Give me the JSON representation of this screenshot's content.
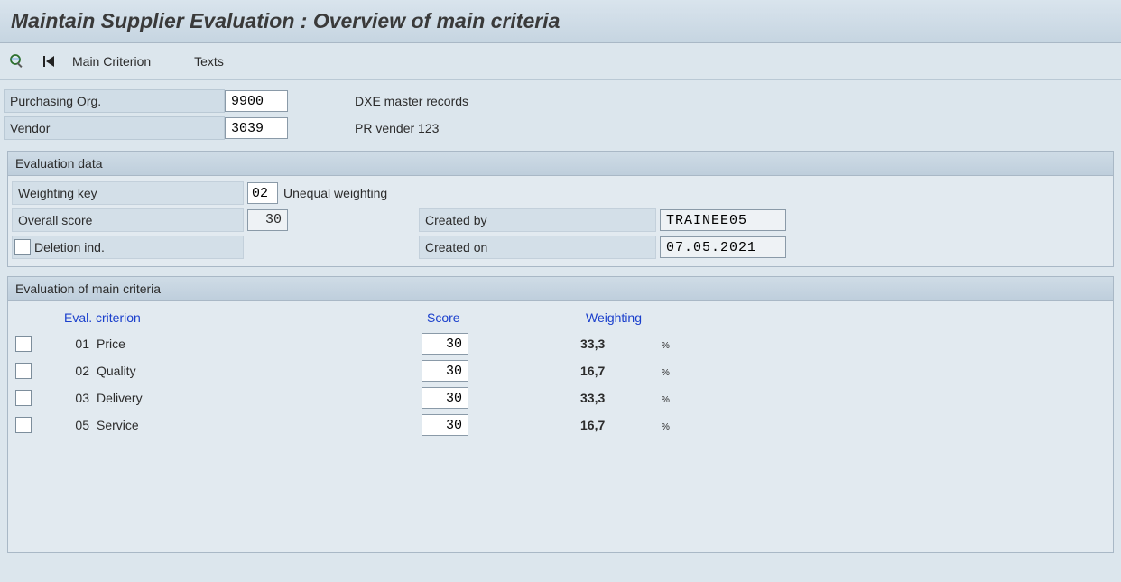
{
  "header": {
    "title": "Maintain Supplier Evaluation : Overview of main criteria"
  },
  "toolbar": {
    "main_criterion": "Main Criterion",
    "texts": "Texts"
  },
  "fields": {
    "purchasing_org_label": "Purchasing Org.",
    "purchasing_org_value": "9900",
    "purchasing_org_desc": "DXE master records",
    "vendor_label": "Vendor",
    "vendor_value": "3039",
    "vendor_desc": "PR vender 123"
  },
  "evaluation_data": {
    "title": "Evaluation data",
    "weighting_key_label": "Weighting key",
    "weighting_key_value": "02",
    "weighting_key_desc": "Unequal weighting",
    "overall_score_label": "Overall score",
    "overall_score_value": "30",
    "deletion_ind_label": "Deletion ind.",
    "created_by_label": "Created by",
    "created_by_value": "TRAINEE05",
    "created_on_label": "Created on",
    "created_on_value": "07.05.2021"
  },
  "criteria": {
    "title": "Evaluation of main criteria",
    "col_eval_criterion": "Eval. criterion",
    "col_score": "Score",
    "col_weighting": "Weighting",
    "pct": "%",
    "rows": [
      {
        "code": "01",
        "name": "Price",
        "score": "30",
        "weighting": "33,3"
      },
      {
        "code": "02",
        "name": "Quality",
        "score": "30",
        "weighting": "16,7"
      },
      {
        "code": "03",
        "name": "Delivery",
        "score": "30",
        "weighting": "33,3"
      },
      {
        "code": "05",
        "name": "Service",
        "score": "30",
        "weighting": "16,7"
      }
    ]
  }
}
